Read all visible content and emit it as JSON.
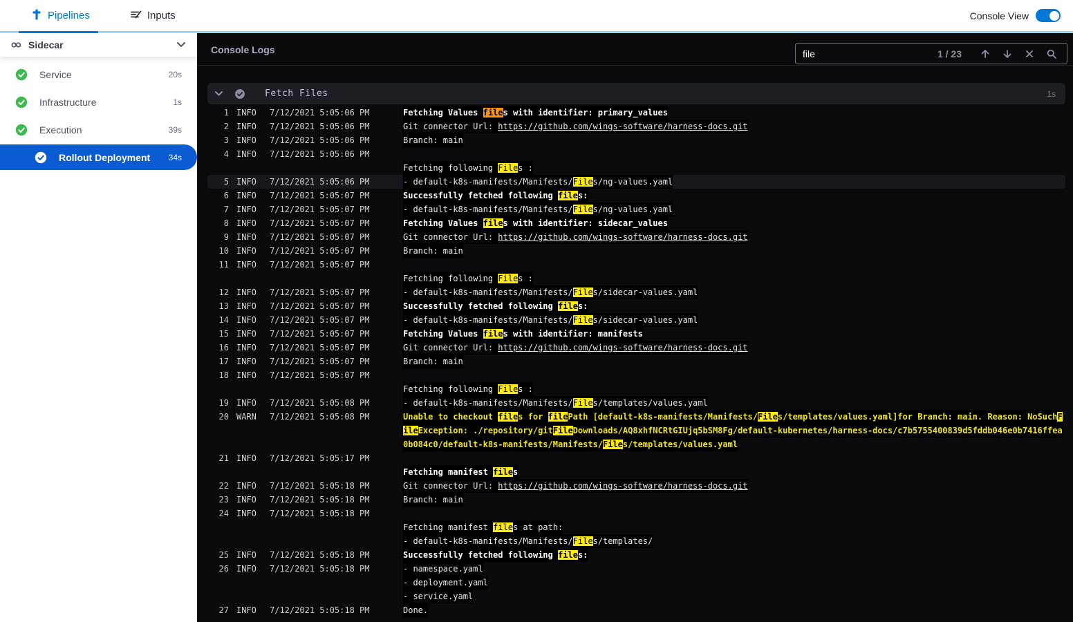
{
  "header": {
    "tabs": [
      {
        "label": "Pipelines",
        "active": true
      },
      {
        "label": "Inputs",
        "active": false
      }
    ],
    "console_view_label": "Console View",
    "console_view_on": true
  },
  "sidebar": {
    "title": "Sidecar",
    "items": [
      {
        "label": "Service",
        "duration": "20s",
        "status": "success",
        "selected": false
      },
      {
        "label": "Infrastructure",
        "duration": "1s",
        "status": "success",
        "selected": false
      },
      {
        "label": "Execution",
        "duration": "39s",
        "status": "success",
        "selected": false
      },
      {
        "label": "Rollout Deployment",
        "duration": "34s",
        "status": "success",
        "selected": true
      }
    ]
  },
  "console": {
    "title": "Console Logs",
    "search": {
      "value": "file",
      "counter": "1 / 23"
    },
    "section": {
      "title": "Fetch Files",
      "duration": "1s"
    },
    "colors": {
      "accent": "#0278d5",
      "selected_item": "#0b5cd3",
      "success_green": "#3eb94e",
      "match_highlight": "#ffec00",
      "current_match_highlight": "#ff9500",
      "warn_text": "#f0e613"
    },
    "log_rows": [
      {
        "n": "1",
        "lvl": "INFO",
        "t": "7/12/2021 5:05:06 PM",
        "b": true,
        "seg": [
          [
            "Fetching Values "
          ],
          [
            "file",
            "c"
          ],
          [
            "s with identifier: primary_values"
          ]
        ]
      },
      {
        "n": "2",
        "lvl": "INFO",
        "t": "7/12/2021 5:05:06 PM",
        "seg": [
          [
            "Git connector Url: "
          ],
          [
            "https://github.com/wings-software/harness-docs.git",
            "u"
          ]
        ]
      },
      {
        "n": "3",
        "lvl": "INFO",
        "t": "7/12/2021 5:05:06 PM",
        "seg": [
          [
            "Branch: main"
          ]
        ]
      },
      {
        "n": "4",
        "lvl": "INFO",
        "t": "7/12/2021 5:05:06 PM",
        "seg": []
      },
      {
        "seg": [
          [
            "Fetching following "
          ],
          [
            "File",
            "m"
          ],
          [
            "s :"
          ]
        ]
      },
      {
        "n": "5",
        "lvl": "INFO",
        "t": "7/12/2021 5:05:06 PM",
        "hl": true,
        "seg": [
          [
            "- default-k8s-manifests/Manifests/"
          ],
          [
            "File",
            "m"
          ],
          [
            "s/ng-values.yaml"
          ]
        ]
      },
      {
        "n": "6",
        "lvl": "INFO",
        "t": "7/12/2021 5:05:07 PM",
        "b": true,
        "seg": [
          [
            "Successfully fetched following "
          ],
          [
            "file",
            "m"
          ],
          [
            "s:"
          ]
        ]
      },
      {
        "n": "7",
        "lvl": "INFO",
        "t": "7/12/2021 5:05:07 PM",
        "seg": [
          [
            "- default-k8s-manifests/Manifests/"
          ],
          [
            "File",
            "m"
          ],
          [
            "s/ng-values.yaml"
          ]
        ]
      },
      {
        "n": "8",
        "lvl": "INFO",
        "t": "7/12/2021 5:05:07 PM",
        "b": true,
        "seg": [
          [
            "Fetching Values "
          ],
          [
            "file",
            "m"
          ],
          [
            "s with identifier: sidecar_values"
          ]
        ]
      },
      {
        "n": "9",
        "lvl": "INFO",
        "t": "7/12/2021 5:05:07 PM",
        "seg": [
          [
            "Git connector Url: "
          ],
          [
            "https://github.com/wings-software/harness-docs.git",
            "u"
          ]
        ]
      },
      {
        "n": "10",
        "lvl": "INFO",
        "t": "7/12/2021 5:05:07 PM",
        "seg": [
          [
            "Branch: main"
          ]
        ]
      },
      {
        "n": "11",
        "lvl": "INFO",
        "t": "7/12/2021 5:05:07 PM",
        "seg": []
      },
      {
        "seg": [
          [
            "Fetching following "
          ],
          [
            "File",
            "m"
          ],
          [
            "s :"
          ]
        ]
      },
      {
        "n": "12",
        "lvl": "INFO",
        "t": "7/12/2021 5:05:07 PM",
        "seg": [
          [
            "- default-k8s-manifests/Manifests/"
          ],
          [
            "File",
            "m"
          ],
          [
            "s/sidecar-values.yaml"
          ]
        ]
      },
      {
        "n": "13",
        "lvl": "INFO",
        "t": "7/12/2021 5:05:07 PM",
        "b": true,
        "seg": [
          [
            "Successfully fetched following "
          ],
          [
            "file",
            "m"
          ],
          [
            "s:"
          ]
        ]
      },
      {
        "n": "14",
        "lvl": "INFO",
        "t": "7/12/2021 5:05:07 PM",
        "seg": [
          [
            "- default-k8s-manifests/Manifests/"
          ],
          [
            "File",
            "m"
          ],
          [
            "s/sidecar-values.yaml"
          ]
        ]
      },
      {
        "n": "15",
        "lvl": "INFO",
        "t": "7/12/2021 5:05:07 PM",
        "b": true,
        "seg": [
          [
            "Fetching Values "
          ],
          [
            "file",
            "m"
          ],
          [
            "s with identifier: manifests"
          ]
        ]
      },
      {
        "n": "16",
        "lvl": "INFO",
        "t": "7/12/2021 5:05:07 PM",
        "seg": [
          [
            "Git connector Url: "
          ],
          [
            "https://github.com/wings-software/harness-docs.git",
            "u"
          ]
        ]
      },
      {
        "n": "17",
        "lvl": "INFO",
        "t": "7/12/2021 5:05:07 PM",
        "seg": [
          [
            "Branch: main"
          ]
        ]
      },
      {
        "n": "18",
        "lvl": "INFO",
        "t": "7/12/2021 5:05:07 PM",
        "seg": []
      },
      {
        "seg": [
          [
            "Fetching following "
          ],
          [
            "File",
            "m"
          ],
          [
            "s :"
          ]
        ]
      },
      {
        "n": "19",
        "lvl": "INFO",
        "t": "7/12/2021 5:05:08 PM",
        "seg": [
          [
            "- default-k8s-manifests/Manifests/"
          ],
          [
            "File",
            "m"
          ],
          [
            "s/templates/values.yaml"
          ]
        ]
      },
      {
        "n": "20",
        "lvl": "WARN",
        "t": "7/12/2021 5:05:08 PM",
        "w": true,
        "seg": [
          [
            "Unable to checkout "
          ],
          [
            "file",
            "m"
          ],
          [
            "s for "
          ],
          [
            "file",
            "m"
          ],
          [
            "Path [default-k8s-manifests/Manifests/"
          ],
          [
            "File",
            "m"
          ],
          [
            "s/templates/values.yaml]for Branch: main. Reason: NoSuch"
          ],
          [
            "F",
            "m"
          ]
        ]
      },
      {
        "w": true,
        "seg": [
          [
            "ile",
            "m"
          ],
          [
            "Exception: ./repository/git"
          ],
          [
            "File",
            "m"
          ],
          [
            "Downloads/AQ8xhfNCRtGIUjq5bSM8Fg/default-kubernetes/harness-docs/c7b5755400839d5fddb046e0b7416ffea"
          ]
        ]
      },
      {
        "w": true,
        "seg": [
          [
            "0b084c0/default-k8s-manifests/Manifests/"
          ],
          [
            "File",
            "m"
          ],
          [
            "s/templates/values.yaml"
          ]
        ]
      },
      {
        "n": "21",
        "lvl": "INFO",
        "t": "7/12/2021 5:05:17 PM",
        "seg": []
      },
      {
        "b": true,
        "seg": [
          [
            "Fetching manifest "
          ],
          [
            "file",
            "m"
          ],
          [
            "s"
          ]
        ]
      },
      {
        "n": "22",
        "lvl": "INFO",
        "t": "7/12/2021 5:05:18 PM",
        "seg": [
          [
            "Git connector Url: "
          ],
          [
            "https://github.com/wings-software/harness-docs.git",
            "u"
          ]
        ]
      },
      {
        "n": "23",
        "lvl": "INFO",
        "t": "7/12/2021 5:05:18 PM",
        "seg": [
          [
            "Branch: main"
          ]
        ]
      },
      {
        "n": "24",
        "lvl": "INFO",
        "t": "7/12/2021 5:05:18 PM",
        "seg": []
      },
      {
        "seg": [
          [
            "Fetching manifest "
          ],
          [
            "file",
            "m"
          ],
          [
            "s at path:"
          ]
        ]
      },
      {
        "seg": [
          [
            "- default-k8s-manifests/Manifests/"
          ],
          [
            "File",
            "m"
          ],
          [
            "s/templates/"
          ]
        ]
      },
      {
        "n": "25",
        "lvl": "INFO",
        "t": "7/12/2021 5:05:18 PM",
        "b": true,
        "seg": [
          [
            "Successfully fetched following "
          ],
          [
            "file",
            "m"
          ],
          [
            "s:"
          ]
        ]
      },
      {
        "n": "26",
        "lvl": "INFO",
        "t": "7/12/2021 5:05:18 PM",
        "seg": [
          [
            "- namespace.yaml"
          ]
        ]
      },
      {
        "seg": [
          [
            "- deployment.yaml"
          ]
        ]
      },
      {
        "seg": [
          [
            "- service.yaml"
          ]
        ]
      },
      {
        "n": "27",
        "lvl": "INFO",
        "t": "7/12/2021 5:05:18 PM",
        "seg": [
          [
            "Done."
          ]
        ]
      }
    ]
  }
}
